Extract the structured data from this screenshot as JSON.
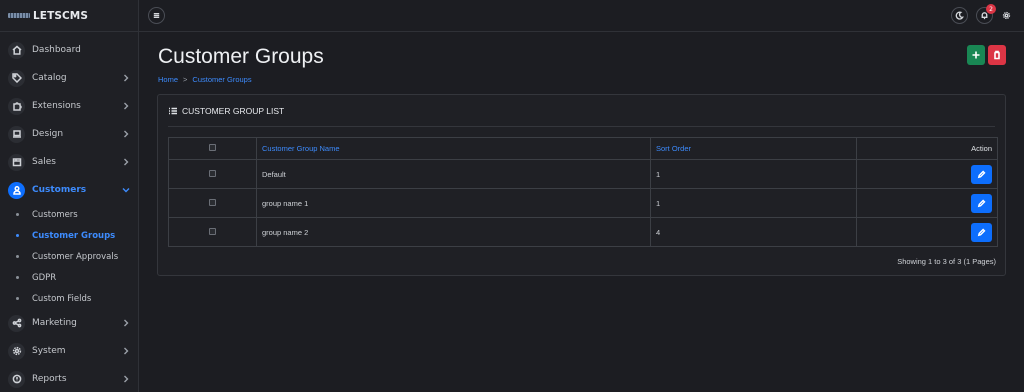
{
  "brand": {
    "name": "LETSCMS"
  },
  "sidebar": {
    "items": [
      {
        "label": "Dashboard",
        "icon": "home-icon",
        "chevron": false
      },
      {
        "label": "Catalog",
        "icon": "tag-icon",
        "chevron": true
      },
      {
        "label": "Extensions",
        "icon": "puzzle-icon",
        "chevron": true
      },
      {
        "label": "Design",
        "icon": "laptop-icon",
        "chevron": true
      },
      {
        "label": "Sales",
        "icon": "cart-icon",
        "chevron": true
      },
      {
        "label": "Customers",
        "icon": "user-icon",
        "chevron": true,
        "active": true
      }
    ],
    "customers_sub": [
      {
        "label": "Customers"
      },
      {
        "label": "Customer Groups",
        "active": true
      },
      {
        "label": "Customer Approvals"
      },
      {
        "label": "GDPR"
      },
      {
        "label": "Custom Fields"
      }
    ],
    "items_after": [
      {
        "label": "Marketing",
        "icon": "share-icon"
      },
      {
        "label": "System",
        "icon": "gear-icon"
      },
      {
        "label": "Reports",
        "icon": "info-icon"
      }
    ]
  },
  "topbar": {
    "notification_count": "2"
  },
  "page": {
    "title": "Customer Groups",
    "breadcrumb": [
      "Home",
      "Customer Groups"
    ]
  },
  "card": {
    "header": "CUSTOMER GROUP LIST",
    "columns": {
      "name": "Customer Group Name",
      "sort": "Sort Order",
      "action": "Action"
    },
    "rows": [
      {
        "name": "Default",
        "sort_order": "1"
      },
      {
        "name": "group name 1",
        "sort_order": "1"
      },
      {
        "name": "group name 2",
        "sort_order": "4"
      }
    ],
    "pagination_info": "Showing 1 to 3 of 3 (1 Pages)"
  },
  "colors": {
    "accent": "#0d6efd",
    "add": "#198754",
    "delete": "#dc3545",
    "background": "#1c1d22"
  }
}
